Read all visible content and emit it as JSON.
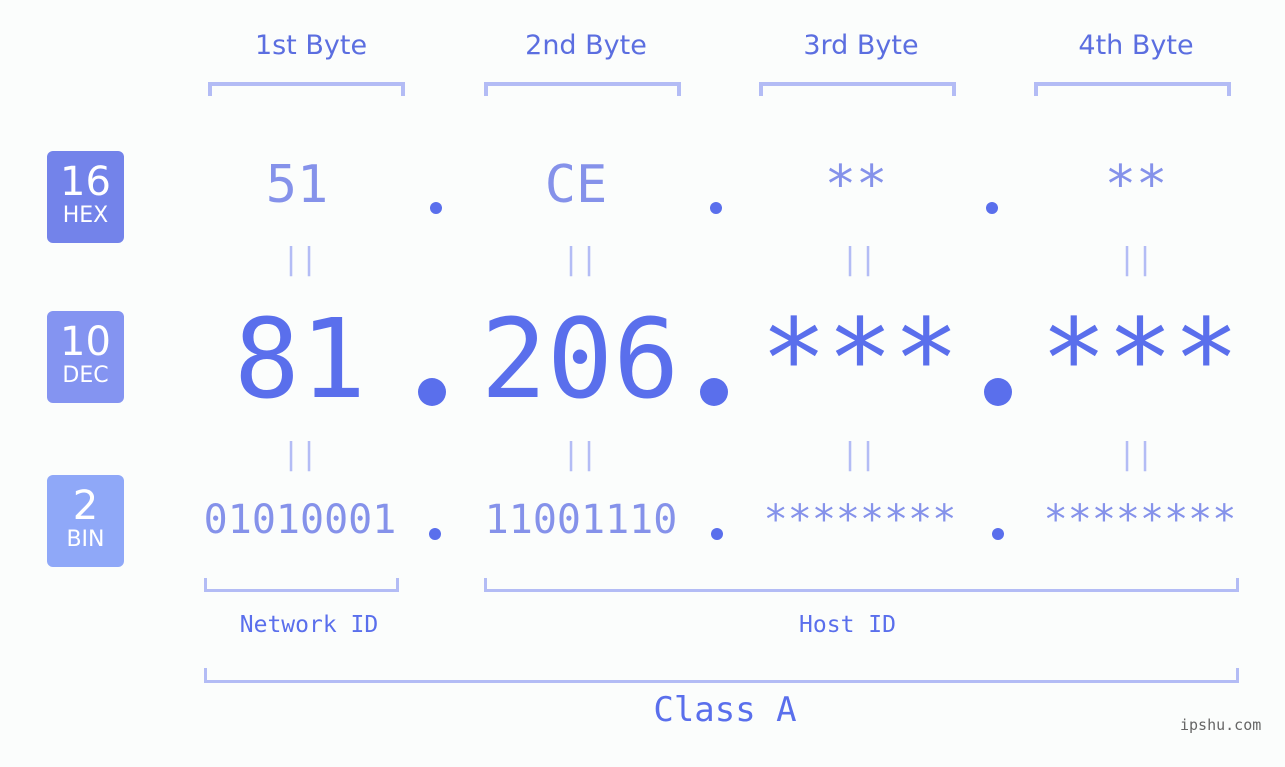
{
  "bases": [
    {
      "num": "16",
      "label": "HEX",
      "color": "#7383ea"
    },
    {
      "num": "10",
      "label": "DEC",
      "color": "#8494f1"
    },
    {
      "num": "2",
      "label": "BIN",
      "color": "#8fa8f8"
    }
  ],
  "bytes": [
    {
      "header": "1st Byte",
      "hex": "51",
      "dec": "81",
      "bin": "01010001"
    },
    {
      "header": "2nd Byte",
      "hex": "CE",
      "dec": "206",
      "bin": "11001110"
    },
    {
      "header": "3rd Byte",
      "hex": "**",
      "dec": "***",
      "bin": "********"
    },
    {
      "header": "4th Byte",
      "hex": "**",
      "dec": "***",
      "bin": "********"
    }
  ],
  "equals_sign": "||",
  "network_id_label": "Network ID",
  "host_id_label": "Host ID",
  "class_label": "Class A",
  "brand": "ipshu.com",
  "colors": {
    "accent": "#5a6fec",
    "muted": "#8592ea",
    "bracket": "#b3bcf5",
    "background": "#fbfdfc"
  }
}
